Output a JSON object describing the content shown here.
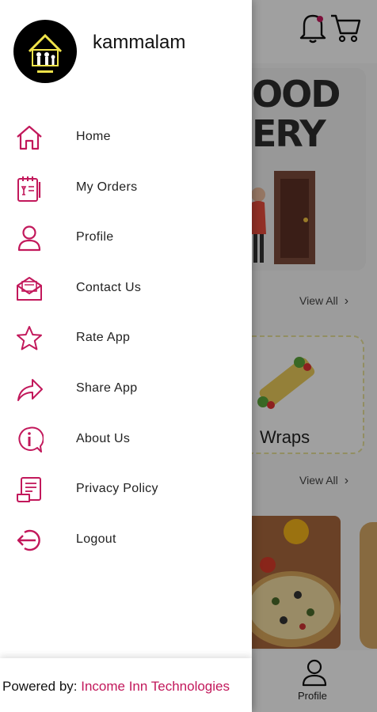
{
  "drawer": {
    "brand_name": "kammalam",
    "menu": [
      {
        "label": "Home",
        "icon": "home-icon"
      },
      {
        "label": "My Orders",
        "icon": "orders-icon"
      },
      {
        "label": "Profile",
        "icon": "profile-icon"
      },
      {
        "label": "Contact Us",
        "icon": "mail-icon"
      },
      {
        "label": "Rate App",
        "icon": "star-icon"
      },
      {
        "label": "Share App",
        "icon": "share-icon"
      },
      {
        "label": "About Us",
        "icon": "info-icon"
      },
      {
        "label": "Privacy Policy",
        "icon": "document-icon"
      },
      {
        "label": "Logout",
        "icon": "logout-icon"
      }
    ],
    "footer": {
      "prefix": "Powered by:",
      "company": "Income Inn Technologies"
    }
  },
  "background": {
    "banner_text_line1": "OOD",
    "banner_text_line2": "ERY",
    "view_all_1": "View All",
    "view_all_2": "View All",
    "category_label": "Wraps",
    "bottom_nav_label": "Profile"
  },
  "colors": {
    "accent": "#c2185b",
    "icon": "#c2185b"
  }
}
